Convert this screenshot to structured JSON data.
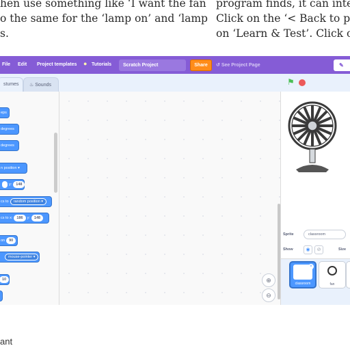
{
  "book": {
    "left_lines": [
      "hen use something like ‘I want the fan",
      "o the same for the ‘lamp on’ and ‘lamp",
      "s."
    ],
    "right_lines": [
      "program finds, it can interp",
      "Click on the ‘< Back to pro",
      "on ‘Learn & Test’. Click on t"
    ],
    "bottom_text": "ant"
  },
  "menubar": {
    "file": "File",
    "edit": "Edit",
    "templates": "Project templates",
    "tutorials": "Tutorials",
    "project_title": "Scratch Project",
    "share": "Share",
    "see_project": "See Project Page",
    "edit_icon": "pencil-icon"
  },
  "tabs": {
    "costumes": "stumes",
    "sounds": "Sounds",
    "sounds_icon": "speaker-icon"
  },
  "blocks": [
    {
      "name": "block-steps",
      "pre": "eps",
      "ovals": [],
      "dropdown": null,
      "post": ""
    },
    {
      "name": "block-turn-right",
      "pre": "",
      "ovals": [],
      "dropdown": null,
      "post": "degrees"
    },
    {
      "name": "block-turn-left",
      "pre": "",
      "ovals": [],
      "dropdown": null,
      "post": "degrees"
    },
    {
      "name": "block-goto",
      "pre": "n position",
      "ovals": [],
      "dropdown": "",
      "post": ""
    },
    {
      "name": "block-goto-xy",
      "pre": "",
      "ovals": [
        "",
        "148"
      ],
      "mid": "y:",
      "post": ""
    },
    {
      "name": "block-glide-random",
      "pre": "cs to",
      "ovals": [],
      "dropdown": "random position",
      "post": ""
    },
    {
      "name": "block-glide-xy",
      "pre": "cs to x:",
      "ovals": [
        "186"
      ],
      "mid": "y:",
      "ovals2": [
        "148"
      ],
      "post": ""
    },
    {
      "name": "block-point-direction",
      "pre": "on",
      "ovals": [
        "90"
      ],
      "post": ""
    },
    {
      "name": "block-point-towards",
      "pre": "",
      "dropdown": "mouse-pointer",
      "post": ""
    },
    {
      "name": "block-change-x",
      "pre": "",
      "ovals": [
        "10"
      ],
      "post": ""
    }
  ],
  "sprite": {
    "label": "Sprite",
    "name": "classroom",
    "show_label": "Show",
    "size_label": "Size",
    "thumbs": [
      "classroom",
      "fan"
    ]
  },
  "icons": {
    "flag": "green-flag-icon",
    "stop": "stop-icon",
    "zoom_in": "zoom-in-icon",
    "zoom_out": "zoom-out-icon",
    "tutorials": "lightbulb-icon"
  }
}
